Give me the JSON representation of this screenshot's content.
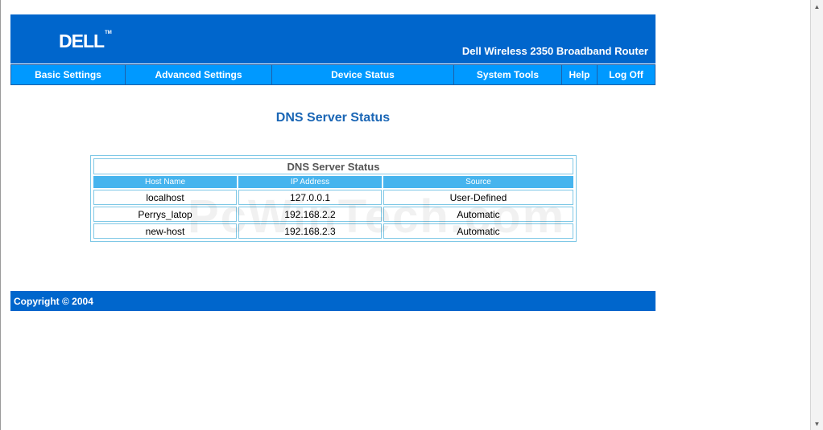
{
  "header": {
    "logo_text": "DELL",
    "logo_tm": "TM",
    "product_title": "Dell Wireless 2350 Broadband Router"
  },
  "nav": {
    "items": [
      {
        "label": "Basic Settings"
      },
      {
        "label": "Advanced Settings"
      },
      {
        "label": "Device Status"
      },
      {
        "label": "System Tools"
      },
      {
        "label": "Help"
      },
      {
        "label": "Log Off"
      }
    ]
  },
  "main": {
    "title": "DNS Server Status",
    "table": {
      "caption": "DNS Server Status",
      "columns": [
        "Host Name",
        "IP Address",
        "Source"
      ],
      "rows": [
        [
          "localhost",
          "127.0.0.1",
          "User-Defined"
        ],
        [
          "Perrys_latop",
          "192.168.2.2",
          "Automatic"
        ],
        [
          "new-host",
          "192.168.2.3",
          "Automatic"
        ]
      ]
    }
  },
  "watermark": "PcWinTech.com",
  "footer": {
    "copyright": "Copyright © 2004"
  },
  "colors": {
    "header_bg": "#0066cc",
    "nav_bg": "#0099ff",
    "title_text": "#1a66b5",
    "table_border": "#7fc8e6",
    "table_header_bg": "#46b4ee"
  }
}
